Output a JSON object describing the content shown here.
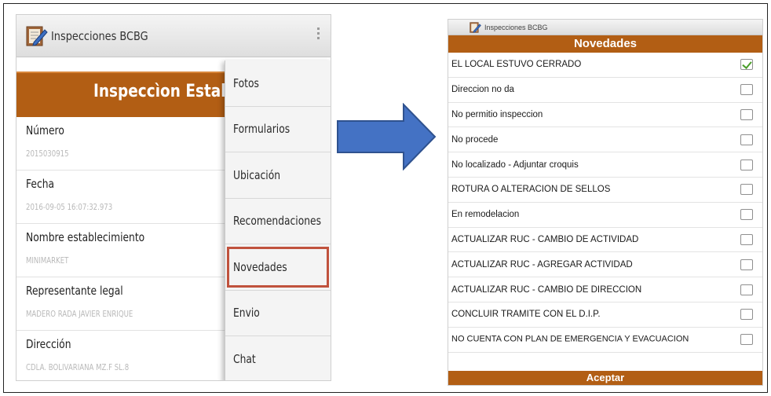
{
  "left": {
    "app_title": "Inspecciones BCBG",
    "header": "Inspeccìon Establecim",
    "fields": [
      {
        "label": "Número",
        "value": "2015030915"
      },
      {
        "label": "Fecha",
        "value": "2016-09-05 16:07:32.973"
      },
      {
        "label": "Nombre establecimiento",
        "value": "MINIMARKET"
      },
      {
        "label": "Representante legal",
        "value": "MADERO RADA JAVIER ENRIQUE"
      },
      {
        "label": "Dirección",
        "value": "CDLA. BOLIVARIANA MZ.F SL.8"
      }
    ],
    "menu": [
      {
        "label": "Fotos"
      },
      {
        "label": "Formularios"
      },
      {
        "label": "Ubicación"
      },
      {
        "label": "Recomendaciones"
      },
      {
        "label": "Novedades",
        "highlighted": true
      },
      {
        "label": "Envio"
      },
      {
        "label": "Chat"
      }
    ]
  },
  "right": {
    "app_title": "Inspecciones BCBG",
    "header": "Novedades",
    "items": [
      {
        "label": "EL LOCAL ESTUVO CERRADO",
        "checked": true
      },
      {
        "label": "Direccion no da",
        "checked": false
      },
      {
        "label": "No permitio inspeccion",
        "checked": false
      },
      {
        "label": "No procede",
        "checked": false
      },
      {
        "label": "No localizado - Adjuntar croquis",
        "checked": false
      },
      {
        "label": "ROTURA O ALTERACION DE SELLOS",
        "checked": false
      },
      {
        "label": "En remodelacion",
        "checked": false
      },
      {
        "label": "ACTUALIZAR RUC - CAMBIO DE ACTIVIDAD",
        "checked": false
      },
      {
        "label": "ACTUALIZAR RUC - AGREGAR ACTIVIDAD",
        "checked": false
      },
      {
        "label": "ACTUALIZAR RUC - CAMBIO DE DIRECCION",
        "checked": false
      },
      {
        "label": "CONCLUIR TRAMITE CON EL D.I.P.",
        "checked": false
      },
      {
        "label": "NO CUENTA CON PLAN DE EMERGENCIA Y EVACUACION",
        "checked": false
      }
    ],
    "accept_label": "Aceptar"
  },
  "colors": {
    "header_brown": "#b25e14",
    "arrow_blue": "#4472c4",
    "menu_highlight": "#c0523d",
    "check_green": "#4a9e2a"
  },
  "icons": {
    "app": "notepad-pencil-icon",
    "overflow": "overflow-menu-icon",
    "arrow": "right-arrow-icon"
  }
}
